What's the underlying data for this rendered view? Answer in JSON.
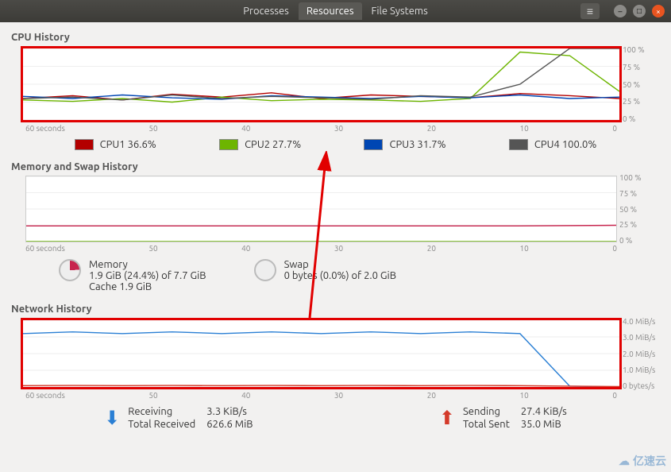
{
  "tabs": {
    "processes": "Processes",
    "resources": "Resources",
    "filesystems": "File Systems",
    "active": "resources"
  },
  "sections": {
    "cpu_title": "CPU History",
    "mem_title": "Memory and Swap History",
    "net_title": "Network History"
  },
  "x_axis": {
    "label": "60 seconds",
    "ticks": [
      "60 seconds",
      "50",
      "40",
      "30",
      "20",
      "10",
      "0"
    ]
  },
  "cpu": {
    "y_ticks": [
      "100 %",
      "75 %",
      "50 %",
      "25 %",
      "0 %"
    ],
    "legend": [
      {
        "name": "CPU1",
        "pct": "36.6%",
        "color": "#b30000"
      },
      {
        "name": "CPU2",
        "pct": "27.7%",
        "color": "#6db500"
      },
      {
        "name": "CPU3",
        "pct": "31.7%",
        "color": "#0046b3"
      },
      {
        "name": "CPU4",
        "pct": "100.0%",
        "color": "#555555"
      }
    ]
  },
  "mem": {
    "y_ticks": [
      "100 %",
      "75 %",
      "50 %",
      "25 %",
      "0 %"
    ],
    "memory": {
      "label": "Memory",
      "line1": "1.9 GiB (24.4%) of 7.7 GiB",
      "line2": "Cache 1.9 GiB",
      "pct": 24.4,
      "color": "#c7254e"
    },
    "swap": {
      "label": "Swap",
      "line1": "0 bytes (0.0%) of 2.0 GiB",
      "pct": 0.0,
      "color": "#6db500"
    }
  },
  "net": {
    "y_ticks": [
      "4.0 MiB/s",
      "3.0 MiB/s",
      "2.0 MiB/s",
      "1.0 MiB/s",
      "0 bytes/s"
    ],
    "recv": {
      "label": "Receiving",
      "rate": "3.3 KiB/s",
      "total_label": "Total Received",
      "total": "626.6 MiB",
      "color": "#2a7fd4"
    },
    "send": {
      "label": "Sending",
      "rate": "27.4 KiB/s",
      "total_label": "Total Sent",
      "total": "35.0 MiB",
      "color": "#d43a2a"
    }
  },
  "chart_data": [
    {
      "type": "line",
      "title": "CPU History",
      "ylabel": "%",
      "ylim": [
        0,
        100
      ],
      "x": [
        60,
        55,
        50,
        45,
        40,
        35,
        30,
        25,
        20,
        15,
        10,
        5,
        0
      ],
      "series": [
        {
          "name": "CPU1",
          "color": "#b30000",
          "values": [
            30,
            34,
            28,
            36,
            32,
            38,
            30,
            35,
            33,
            31,
            37,
            34,
            30
          ]
        },
        {
          "name": "CPU2",
          "color": "#6db500",
          "values": [
            28,
            26,
            30,
            25,
            32,
            27,
            29,
            28,
            26,
            30,
            95,
            90,
            40
          ]
        },
        {
          "name": "CPU3",
          "color": "#0046b3",
          "values": [
            33,
            30,
            35,
            31,
            29,
            34,
            32,
            30,
            33,
            31,
            35,
            30,
            32
          ]
        },
        {
          "name": "CPU4",
          "color": "#555555",
          "values": [
            30,
            32,
            28,
            35,
            30,
            33,
            31,
            29,
            34,
            32,
            50,
            100,
            100
          ]
        }
      ]
    },
    {
      "type": "line",
      "title": "Memory and Swap History",
      "ylabel": "%",
      "ylim": [
        0,
        100
      ],
      "x": [
        60,
        50,
        40,
        30,
        20,
        10,
        0
      ],
      "series": [
        {
          "name": "Memory",
          "color": "#c7254e",
          "values": [
            24,
            24,
            24,
            24,
            24,
            24,
            25
          ]
        },
        {
          "name": "Swap",
          "color": "#6db500",
          "values": [
            0,
            0,
            0,
            0,
            0,
            0,
            0
          ]
        }
      ]
    },
    {
      "type": "line",
      "title": "Network History",
      "ylabel": "MiB/s",
      "ylim": [
        0,
        4
      ],
      "x": [
        60,
        55,
        50,
        45,
        40,
        35,
        30,
        25,
        20,
        15,
        10,
        5,
        0
      ],
      "series": [
        {
          "name": "Receiving",
          "color": "#2a7fd4",
          "values": [
            3.2,
            3.3,
            3.2,
            3.3,
            3.2,
            3.3,
            3.2,
            3.3,
            3.2,
            3.3,
            3.2,
            0.05,
            0.003
          ]
        },
        {
          "name": "Sending",
          "color": "#d43a2a",
          "values": [
            0.08,
            0.09,
            0.08,
            0.09,
            0.08,
            0.09,
            0.08,
            0.09,
            0.08,
            0.09,
            0.08,
            0.05,
            0.027
          ]
        }
      ]
    }
  ],
  "watermark": "亿速云"
}
